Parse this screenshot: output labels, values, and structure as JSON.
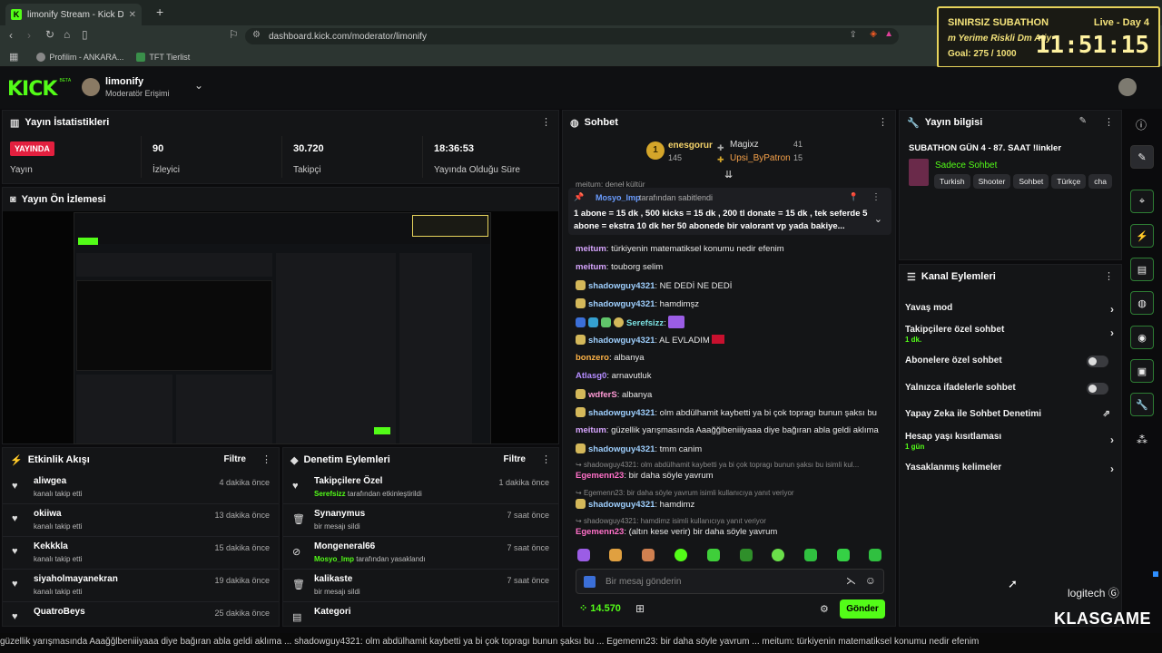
{
  "browser": {
    "tab_title": "limonify Stream - Kick Dashb",
    "tab_icon": "kick-favicon",
    "new_tab": "+",
    "url": "dashboard.kick.com/moderator/limonify",
    "bookmarks": [
      {
        "label": "Profilim - ANKARA..."
      },
      {
        "label": "TFT Tierlist"
      }
    ]
  },
  "overlay": {
    "title": "SINIRSIZ SUBATHON",
    "subtitle": "m Yerime Riskli Dm Atiy",
    "goal": "Goal: 275 / 1000",
    "live": "Live - Day 4",
    "timer": "11:51:15"
  },
  "header": {
    "logo": "KICK",
    "logo_sup": "BETA",
    "channel": "limonify",
    "role": "Moderatör Erişimi"
  },
  "stats": {
    "title": "Yayın İstatistikleri",
    "live_badge": "YAYINDA",
    "live_label": "Yayın",
    "viewers": "90",
    "viewers_label": "İzleyici",
    "followers": "30.720",
    "followers_label": "Takipçi",
    "uptime": "18:36:53",
    "uptime_label": "Yayında Olduğu Süre"
  },
  "preview": {
    "title": "Yayın Ön İzlemesi"
  },
  "activity": {
    "title": "Etkinlik Akışı",
    "filter": "Filtre",
    "items": [
      {
        "name": "aliwgea",
        "sub": "kanalı takip etti",
        "time": "4 dakika önce"
      },
      {
        "name": "okiiwa",
        "sub": "kanalı takip etti",
        "time": "13 dakika önce"
      },
      {
        "name": "Kekkkla",
        "sub": "kanalı takip etti",
        "time": "15 dakika önce"
      },
      {
        "name": "siyaholmayanekran",
        "sub": "kanalı takip etti",
        "time": "19 dakika önce"
      },
      {
        "name": "QuatroBeys",
        "sub": "",
        "time": "25 dakika önce"
      }
    ]
  },
  "moderation": {
    "title": "Denetim Eylemleri",
    "filter": "Filtre",
    "items": [
      {
        "name": "Takipçilere Özel",
        "actor": "Serefsizz",
        "sub": "tarafından etkinleştirildi",
        "time": "1 dakika önce",
        "icon": "heart-icon"
      },
      {
        "name": "Synanymus",
        "actor": "",
        "sub": "bir mesajı sildi",
        "time": "7 saat önce",
        "icon": "trash-icon"
      },
      {
        "name": "Mongeneral66",
        "actor": "Mosyo_lmp",
        "sub": "tarafından yasaklandı",
        "time": "7 saat önce",
        "icon": "ban-icon"
      },
      {
        "name": "kalikaste",
        "actor": "",
        "sub": "bir mesajı sildi",
        "time": "7 saat önce",
        "icon": "trash-icon"
      },
      {
        "name": "Kategori",
        "actor": "",
        "sub": "",
        "time": "",
        "icon": "category-icon"
      }
    ]
  },
  "chat": {
    "title": "Sohbet",
    "top_gifter_rank": "1",
    "top_gifter": "enesgorur",
    "top_gifter_count": "145",
    "gifters": [
      {
        "name": "Magixz",
        "count": "41"
      },
      {
        "name": "Upsi_ByPatron",
        "count": "15"
      }
    ],
    "partial_top": "meitum: deneł kültür",
    "pinned_by_user": "Mosyo_lmp",
    "pinned_by_text": "tarafından sabitlendi",
    "pinned_text_1": "1 abone = 15 dk , 500 kicks = 15 dk , 200 tl donate = 15 dk , tek seferde 5",
    "pinned_text_2": "abone = ekstra 10 dk her 50 abonede bir valorant vp yada bakiye...",
    "messages": [
      {
        "user": "meitum",
        "text": "türkiyenin matematiksel konumu nedir efenim",
        "color": "#d8a6ff"
      },
      {
        "user": "meitum",
        "text": "touborg selim",
        "color": "#d8a6ff"
      },
      {
        "user": "shadowguy4321",
        "text": "NE DEDİ NE DEDİ",
        "color": "#9fd0ff"
      },
      {
        "user": "shadowguy4321",
        "text": "hamdimşz",
        "color": "#9fd0ff"
      },
      {
        "user": "Serefsizz",
        "text": "",
        "color": "#7be0e0"
      },
      {
        "user": "shadowguy4321",
        "text": "AL EVLADIM",
        "color": "#9fd0ff"
      },
      {
        "user": "bonzero",
        "text": "albanya",
        "color": "#ffb347"
      },
      {
        "user": "Atlasg0",
        "text": "arnavutluk",
        "color": "#b48cff"
      },
      {
        "user": "wdferS",
        "text": "albanya",
        "color": "#ff9ad5"
      },
      {
        "user": "shadowguy4321",
        "text": "olm abdülhamit kaybetti ya bi çok topragı bunun şaksı bu",
        "color": "#9fd0ff"
      },
      {
        "user": "meitum",
        "text": "güzellik yarışmasında Aaağğlbeniiiyaaa diye bağıran abla geldi aklıma",
        "color": "#d8a6ff"
      },
      {
        "user": "shadowguy4321",
        "text": "tmm canim",
        "color": "#9fd0ff"
      }
    ],
    "reply1_quote": "shadowguy4321: olm abdülhamit kaybetti ya bi çok topragı bunun şaksı bu isimli kul...",
    "reply1_user": "Egemenn23",
    "reply1_text": "bir daha söyle yavrum",
    "reply2_quote": "Egemenn23: bir daha söyle yavrum isimli kullanıcıya yanıt veriyor",
    "reply2_user": "shadowguy4321",
    "reply2_text": "hamdimz",
    "reply3_quote": "shadowguy4321: hamdimz isimli kullanıcıya yanıt veriyor",
    "reply3_user": "Egemenn23",
    "reply3_text": "(altın kese verir) bir daha söyle yavrum",
    "input_placeholder": "Bir mesaj gönderin",
    "balance": "14.570",
    "send": "Gönder"
  },
  "info": {
    "title": "Yayın bilgisi",
    "stream_title": "SUBATHON GÜN 4 - 87. SAAT",
    "links": "!linkler",
    "category": "Sadece Sohbet",
    "tags": [
      "Turkish",
      "Shooter",
      "Sohbet",
      "Türkçe",
      "cha"
    ]
  },
  "channel_actions": {
    "title": "Kanal Eylemleri",
    "slow_mode": "Yavaş mod",
    "followers_only": "Takipçilere özel sohbet",
    "followers_only_value": "1 dk.",
    "subs_only": "Abonelere özel sohbet",
    "emotes_only": "Yalnızca ifadelerle sohbet",
    "ai_mod": "Yapay Zeka ile Sohbet Denetimi",
    "account_age": "Hesap yaşı kısıtlaması",
    "account_age_value": "1 gün",
    "banned_words": "Yasaklanmış kelimeler"
  },
  "branding": {
    "logitech": "logitech",
    "klasgame": "KLASGAME"
  },
  "ticker": {
    "text": "güzellik yarışmasında Aaağğlbeniiiyaaa diye bağıran abla geldi aklıma ... shadowguy4321: olm abdülhamit kaybetti ya bi çok topragı bunun şaksı bu ... Egemenn23: bir daha söyle yavrum ... meitum: türkiyenin matematiksel konumu nedir efenim"
  },
  "colors": {
    "kick_green": "#53fc18",
    "overlay_gold": "#e7d45c",
    "live_red": "#e3203f",
    "sub_green": "#53fc18"
  }
}
